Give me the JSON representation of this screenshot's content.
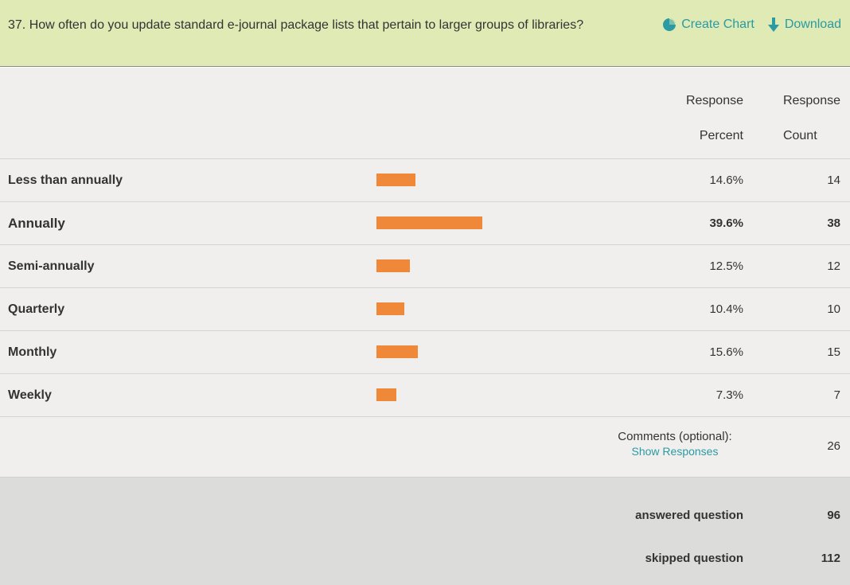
{
  "question": {
    "text": "37. How often do you update standard e-journal package lists that pertain to larger groups of libraries?"
  },
  "actions": {
    "create_chart": "Create Chart",
    "download": "Download"
  },
  "columns": {
    "percent_line1": "Response",
    "percent_line2": "Percent",
    "count_line1": "Response",
    "count_line2": "Count"
  },
  "rows": [
    {
      "label": "Less than annually",
      "percent": "14.6%",
      "count": "14",
      "value": 14.6
    },
    {
      "label": "Annually",
      "percent": "39.6%",
      "count": "38",
      "value": 39.6
    },
    {
      "label": "Semi-annually",
      "percent": "12.5%",
      "count": "12",
      "value": 12.5
    },
    {
      "label": "Quarterly",
      "percent": "10.4%",
      "count": "10",
      "value": 10.4
    },
    {
      "label": "Monthly",
      "percent": "15.6%",
      "count": "15",
      "value": 15.6
    },
    {
      "label": "Weekly",
      "percent": "7.3%",
      "count": "7",
      "value": 7.3
    }
  ],
  "comments": {
    "label": "Comments (optional):",
    "link": "Show Responses",
    "count": "26"
  },
  "summary": {
    "answered_label": "answered question",
    "answered_value": "96",
    "skipped_label": "skipped question",
    "skipped_value": "112"
  },
  "colors": {
    "bar": "#f0883a",
    "header_bg": "#dfeab5",
    "link": "#2a9aa3"
  },
  "icons": {
    "create_chart": "pie-chart-icon",
    "download": "download-arrow-icon"
  }
}
